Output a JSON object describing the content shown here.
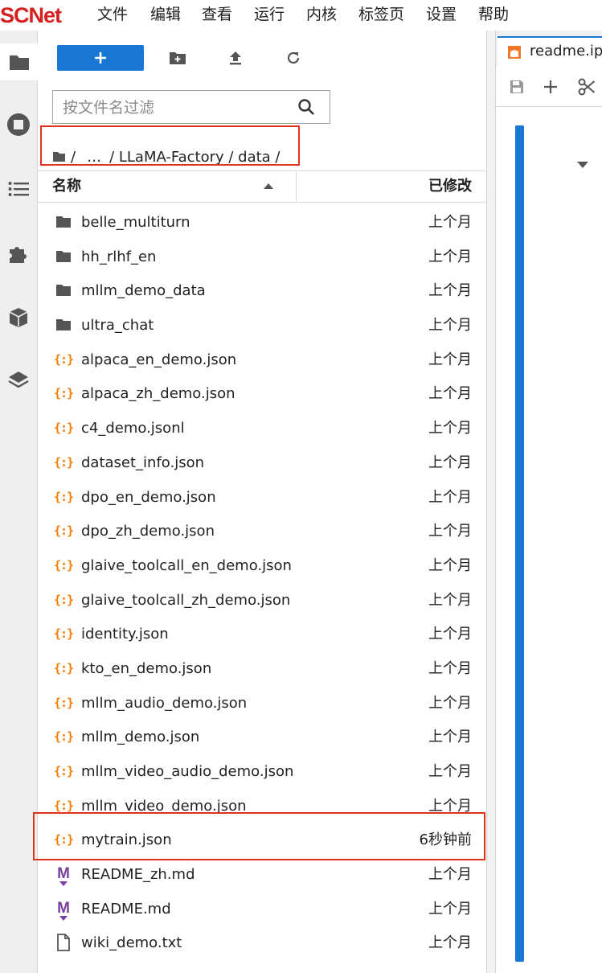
{
  "app": {
    "logo_text": "SCNet",
    "brand_color": "#d71f1f",
    "accent_color": "#1976d2",
    "highlight_color": "#e0321e"
  },
  "menu": [
    "文件",
    "编辑",
    "查看",
    "运行",
    "内核",
    "标签页",
    "设置",
    "帮助"
  ],
  "activity_bar": [
    {
      "icon": "folder-icon",
      "active": true
    },
    {
      "icon": "stop-circle-icon",
      "active": false
    },
    {
      "icon": "list-icon",
      "active": false
    },
    {
      "icon": "puzzle-icon",
      "active": false
    },
    {
      "icon": "cube-icon",
      "active": false
    },
    {
      "icon": "layers-icon",
      "active": false
    }
  ],
  "toolbar": {
    "new_icon": "plus-icon",
    "new_folder_icon": "new-folder-icon",
    "upload_icon": "upload-icon",
    "refresh_icon": "refresh-icon"
  },
  "filter": {
    "placeholder": "按文件名过滤",
    "value": ""
  },
  "breadcrumb": {
    "root_icon": "folder-icon",
    "parts": [
      "/",
      "…",
      "/ LLaMA-Factory / data /"
    ]
  },
  "columns": {
    "name": "名称",
    "modified": "已修改",
    "sort": "ascending"
  },
  "files": [
    {
      "name": "belle_multiturn",
      "type": "folder",
      "modified": "上个月"
    },
    {
      "name": "hh_rlhf_en",
      "type": "folder",
      "modified": "上个月"
    },
    {
      "name": "mllm_demo_data",
      "type": "folder",
      "modified": "上个月"
    },
    {
      "name": "ultra_chat",
      "type": "folder",
      "modified": "上个月"
    },
    {
      "name": "alpaca_en_demo.json",
      "type": "json",
      "modified": "上个月"
    },
    {
      "name": "alpaca_zh_demo.json",
      "type": "json",
      "modified": "上个月"
    },
    {
      "name": "c4_demo.jsonl",
      "type": "json",
      "modified": "上个月"
    },
    {
      "name": "dataset_info.json",
      "type": "json",
      "modified": "上个月"
    },
    {
      "name": "dpo_en_demo.json",
      "type": "json",
      "modified": "上个月"
    },
    {
      "name": "dpo_zh_demo.json",
      "type": "json",
      "modified": "上个月"
    },
    {
      "name": "glaive_toolcall_en_demo.json",
      "type": "json",
      "modified": "上个月"
    },
    {
      "name": "glaive_toolcall_zh_demo.json",
      "type": "json",
      "modified": "上个月"
    },
    {
      "name": "identity.json",
      "type": "json",
      "modified": "上个月"
    },
    {
      "name": "kto_en_demo.json",
      "type": "json",
      "modified": "上个月"
    },
    {
      "name": "mllm_audio_demo.json",
      "type": "json",
      "modified": "上个月"
    },
    {
      "name": "mllm_demo.json",
      "type": "json",
      "modified": "上个月"
    },
    {
      "name": "mllm_video_audio_demo.json",
      "type": "json",
      "modified": "上个月"
    },
    {
      "name": "mllm_video_demo.json",
      "type": "json",
      "modified": "上个月"
    },
    {
      "name": "mytrain.json",
      "type": "json",
      "modified": "6秒钟前",
      "highlighted": true
    },
    {
      "name": "README_zh.md",
      "type": "markdown",
      "modified": "上个月"
    },
    {
      "name": "README.md",
      "type": "markdown",
      "modified": "上个月"
    },
    {
      "name": "wiki_demo.txt",
      "type": "text",
      "modified": "上个月"
    }
  ],
  "notebook": {
    "tab_label": "readme.ipynb",
    "tab_icon": "notebook-icon",
    "toolbar_icons": [
      "save-icon",
      "plus-icon",
      "scissors-icon"
    ]
  }
}
